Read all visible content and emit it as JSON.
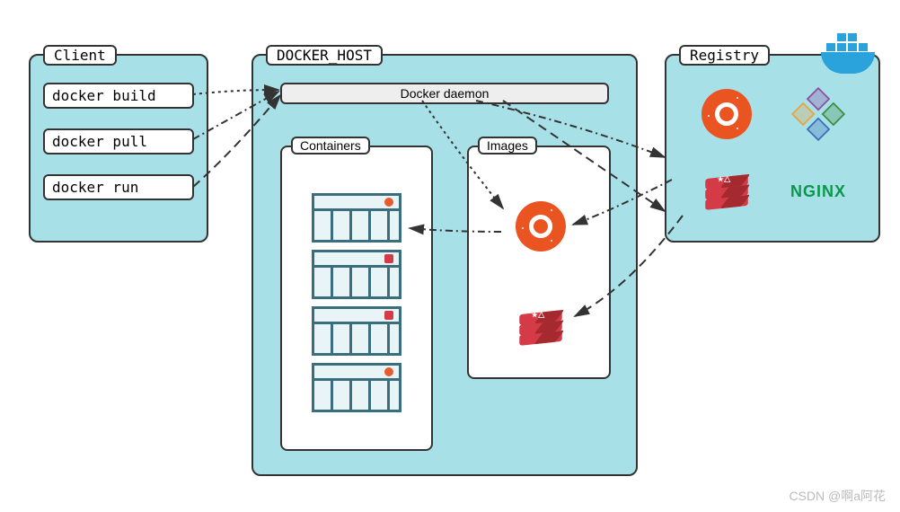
{
  "client": {
    "title": "Client",
    "commands": [
      "docker build",
      "docker pull",
      "docker run"
    ]
  },
  "host": {
    "title": "DOCKER_HOST",
    "daemon": "Docker daemon",
    "containers_label": "Containers",
    "images_label": "Images",
    "container_count": 4,
    "container_badges": [
      "ubuntu",
      "redis",
      "redis",
      "ubuntu"
    ],
    "image_items": [
      "ubuntu",
      "redis"
    ]
  },
  "registry": {
    "title": "Registry",
    "items": [
      "ubuntu",
      "centos",
      "redis",
      "nginx"
    ],
    "nginx_label": "NGINX"
  },
  "attribution": "CSDN @啊a阿花"
}
